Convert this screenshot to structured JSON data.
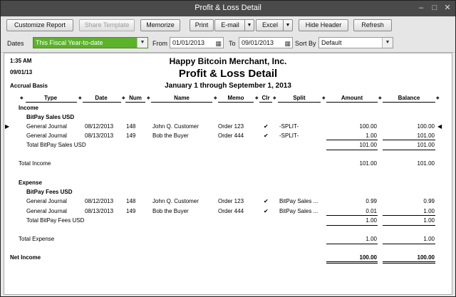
{
  "window": {
    "title": "Profit & Loss Detail"
  },
  "window_controls": {
    "minimize": "–",
    "maximize": "□",
    "close": "✕"
  },
  "toolbar": {
    "customize": "Customize Report",
    "share": "Share Template",
    "memorize": "Memorize",
    "print": "Print",
    "email": "E-mail",
    "excel": "Excel",
    "hide_header": "Hide Header",
    "refresh": "Refresh"
  },
  "filters": {
    "dates_label": "Dates",
    "dates_value": "This Fiscal Year-to-date",
    "from_label": "From",
    "from_value": "01/01/2013",
    "to_label": "To",
    "to_value": "09/01/2013",
    "sortby_label": "Sort By",
    "sortby_value": "Default"
  },
  "report": {
    "time": "1:35 AM",
    "date": "09/01/13",
    "basis": "Accrual Basis",
    "company": "Happy Bitcoin Merchant, Inc.",
    "title": "Profit & Loss Detail",
    "period": "January 1 through September 1, 2013",
    "columns": [
      "Type",
      "Date",
      "Num",
      "Name",
      "Memo",
      "Clr",
      "Split",
      "Amount",
      "Balance"
    ],
    "income_label": "Income",
    "bitpay_sales_label": "BitPay Sales USD",
    "income_rows": [
      {
        "type": "General Journal",
        "date": "08/12/2013",
        "num": "148",
        "name": "John Q. Customer",
        "memo": "Order 123",
        "clr": "✔",
        "split": "-SPLIT-",
        "amount": "100.00",
        "balance": "100.00"
      },
      {
        "type": "General Journal",
        "date": "08/13/2013",
        "num": "149",
        "name": "Bob the Buyer",
        "memo": "Order 444",
        "clr": "✔",
        "split": "-SPLIT-",
        "amount": "1.00",
        "balance": "101.00"
      }
    ],
    "total_bitpay_sales_label": "Total BitPay Sales USD",
    "total_bitpay_sales_amount": "101.00",
    "total_bitpay_sales_balance": "101.00",
    "total_income_label": "Total Income",
    "total_income_amount": "101.00",
    "total_income_balance": "101.00",
    "expense_label": "Expense",
    "bitpay_fees_label": "BitPay Fees USD",
    "expense_rows": [
      {
        "type": "General Journal",
        "date": "08/12/2013",
        "num": "148",
        "name": "John Q. Customer",
        "memo": "Order 123",
        "clr": "✔",
        "split": "BitPay Sales ...",
        "amount": "0.99",
        "balance": "0.99"
      },
      {
        "type": "General Journal",
        "date": "08/13/2013",
        "num": "149",
        "name": "Bob the Buyer",
        "memo": "Order 444",
        "clr": "✔",
        "split": "BitPay Sales ...",
        "amount": "0.01",
        "balance": "1.00"
      }
    ],
    "total_bitpay_fees_label": "Total BitPay Fees USD",
    "total_bitpay_fees_amount": "1.00",
    "total_bitpay_fees_balance": "1.00",
    "total_expense_label": "Total Expense",
    "total_expense_amount": "1.00",
    "total_expense_balance": "1.00",
    "net_income_label": "Net Income",
    "net_income_amount": "100.00",
    "net_income_balance": "100.00"
  }
}
